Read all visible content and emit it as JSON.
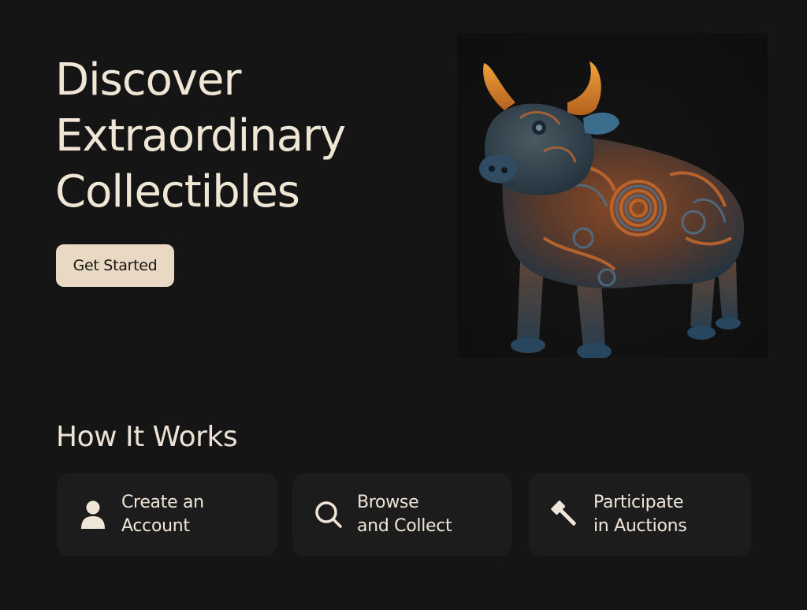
{
  "hero": {
    "title_lines": [
      "Discover",
      "Extraordinary",
      "Collectibles"
    ],
    "cta_label": "Get Started",
    "image_subject": "ornate painted bull sculpture"
  },
  "how_it_works": {
    "title": "How It Works",
    "steps": [
      {
        "icon": "user-icon",
        "lines": [
          "Create an",
          "Account"
        ]
      },
      {
        "icon": "search-icon",
        "lines": [
          "Browse",
          "and Collect"
        ]
      },
      {
        "icon": "gavel-icon",
        "lines": [
          "Participate",
          "in Auctions"
        ]
      }
    ]
  },
  "colors": {
    "background": "#161515",
    "text_primary": "#f0e6d6",
    "button_background": "#e9d9c4",
    "card_background": "#1d1c1c"
  }
}
